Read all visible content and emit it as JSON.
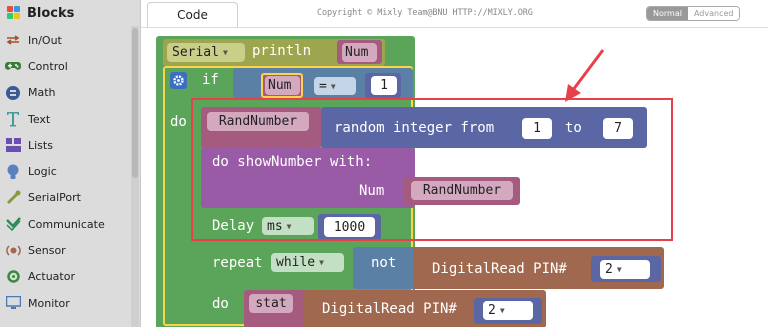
{
  "sidebar": {
    "title": "Blocks",
    "items": [
      {
        "label": "In/Out",
        "icon": "in-out-icon"
      },
      {
        "label": "Control",
        "icon": "gamepad-icon"
      },
      {
        "label": "Math",
        "icon": "math-icon"
      },
      {
        "label": "Text",
        "icon": "text-icon"
      },
      {
        "label": "Lists",
        "icon": "lists-icon"
      },
      {
        "label": "Logic",
        "icon": "lightbulb-icon"
      },
      {
        "label": "SerialPort",
        "icon": "serialport-icon"
      },
      {
        "label": "Communicate",
        "icon": "communicate-icon"
      },
      {
        "label": "Sensor",
        "icon": "sensor-icon"
      },
      {
        "label": "Actuator",
        "icon": "actuator-icon"
      },
      {
        "label": "Monitor",
        "icon": "monitor-icon"
      }
    ]
  },
  "topbar": {
    "tab_code": "Code",
    "copyright": "Copyright © Mixly Team@BNU HTTP://MIXLY.ORG",
    "mode_normal": "Normal",
    "mode_advanced": "Advanced"
  },
  "blocks": {
    "serial": "Serial",
    "println": "println",
    "num": "Num",
    "if": "if",
    "num_var": "Num",
    "eq_op": "=",
    "one": "1",
    "do": "do",
    "randnumber": "RandNumber",
    "random_integer_from": "random integer from",
    "from_val": "1",
    "to": "to",
    "to_val": "7",
    "do_showNumber": "do showNumber with:",
    "num_param": "Num",
    "randnumber_arg": "RandNumber",
    "delay": "Delay",
    "ms": "ms",
    "delay_val": "1000",
    "repeat": "repeat",
    "while": "while",
    "not": "not",
    "digitalread_pin": "DigitalRead PIN#",
    "pin_val": "2",
    "do2": "do",
    "stat": "stat",
    "digitalread_pin2": "DigitalRead PIN#",
    "pin_val2": "2"
  },
  "colors": {
    "control_green": "#5ba55b",
    "serial_olive": "#9ea54f",
    "variable_purple": "#a55b80",
    "math_blue": "#5b67a5",
    "procedure_purple": "#995ba5",
    "logic_slate": "#5b80a5",
    "io_brown": "#a0694f",
    "highlight_yellow": "#fcd34d",
    "annotation_red": "#e8404a"
  }
}
